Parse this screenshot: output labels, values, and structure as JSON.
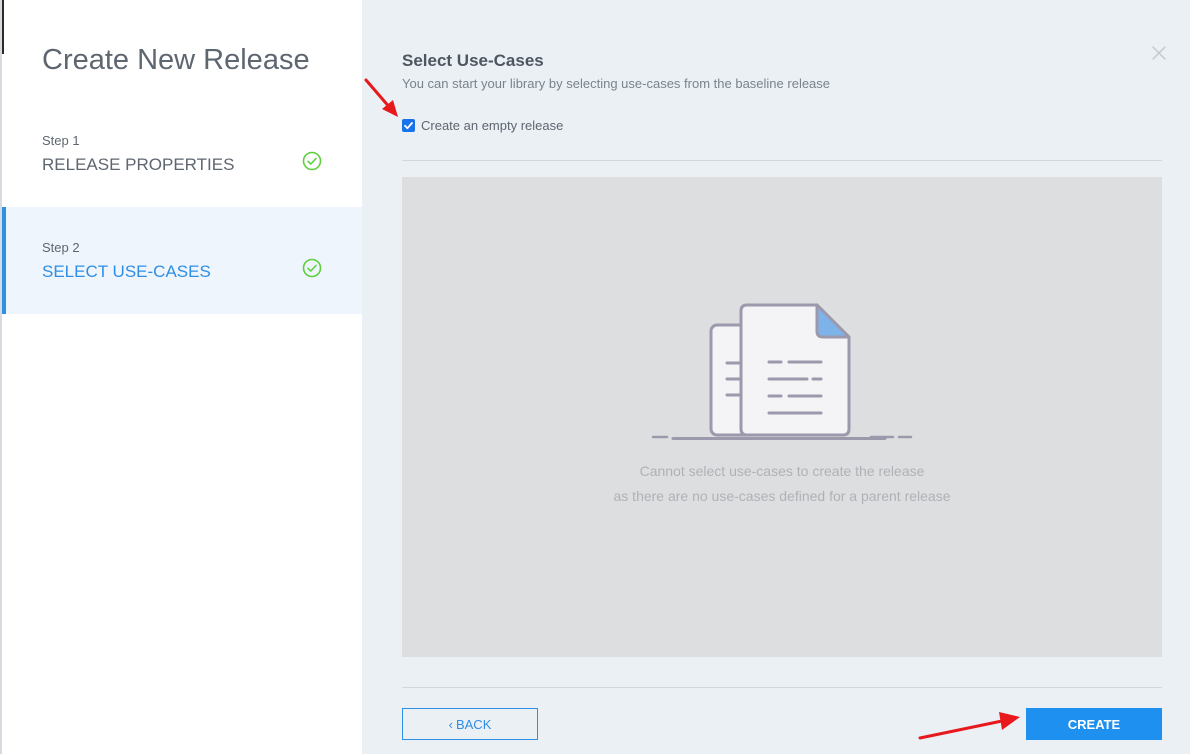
{
  "wizard": {
    "title": "Create New Release",
    "steps": [
      {
        "number": "Step 1",
        "label": "RELEASE PROPERTIES",
        "completed": true,
        "active": false
      },
      {
        "number": "Step 2",
        "label": "SELECT USE-CASES",
        "completed": true,
        "active": true
      }
    ]
  },
  "panel": {
    "title": "Select Use-Cases",
    "subtitle": "You can start your library by selecting use-cases from the baseline release",
    "checkbox_label": "Create an empty release",
    "checkbox_checked": true,
    "empty_message_line1": "Cannot select use-cases to create the release",
    "empty_message_line2": "as there are no use-cases defined for a parent release"
  },
  "actions": {
    "back_label": "BACK",
    "create_label": "CREATE"
  },
  "icons": {
    "close": "close-icon",
    "step_complete": "check-circle-icon",
    "back": "chevron-left-icon",
    "empty_state": "documents-icon"
  },
  "colors": {
    "accent": "#2f8fe5",
    "primary_button": "#1e90f0",
    "check_green": "#5fcf3f",
    "annotation_red": "#e8191c",
    "panel_bg": "#ebf0f5",
    "empty_bg": "#dddee0"
  }
}
